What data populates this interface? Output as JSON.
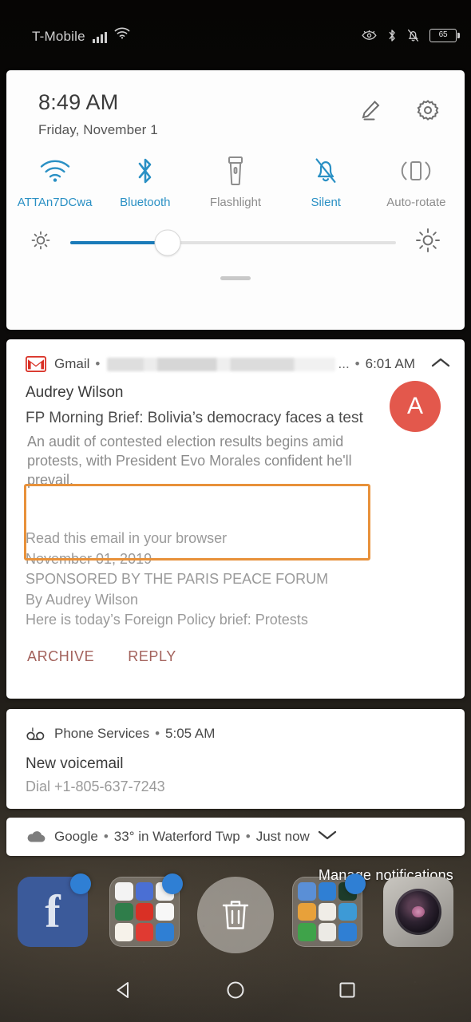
{
  "status_bar": {
    "carrier": "T-Mobile",
    "signal_icon": "signal-bars-icon",
    "wifi_icon": "wifi-icon",
    "eye_comfort_icon": "eye-comfort-icon",
    "bluetooth_icon": "bluetooth-icon",
    "silent_icon": "bell-slash-icon",
    "battery_level": "65"
  },
  "quick_settings": {
    "time": "8:49 AM",
    "date": "Friday, November 1",
    "edit_icon": "pencil-edit-icon",
    "settings_icon": "gear-icon",
    "active_color": "#2a90c4",
    "inactive_color": "#8d8d8d",
    "tiles": [
      {
        "label": "ATTAn7DCwa",
        "icon": "wifi-icon",
        "state": "on"
      },
      {
        "label": "Bluetooth",
        "icon": "bluetooth-icon",
        "state": "on"
      },
      {
        "label": "Flashlight",
        "icon": "flashlight-icon",
        "state": "off"
      },
      {
        "label": "Silent",
        "icon": "bell-slash-icon",
        "state": "on"
      },
      {
        "label": "Auto-rotate",
        "icon": "auto-rotate-icon",
        "state": "off"
      }
    ],
    "brightness": {
      "low_icon": "brightness-low-icon",
      "high_icon": "brightness-high-icon",
      "value_percent": "30"
    },
    "drag_handle": "panel-drag-handle"
  },
  "notifications": {
    "gmail": {
      "app_icon": "gmail-icon",
      "app_name": "Gmail",
      "account": "",
      "account_truncation": "...",
      "time": "6:01 AM",
      "collapse_icon": "chevron-up-icon",
      "sender": "Audrey Wilson",
      "subject": "FP Morning Brief: Bolivia’s democracy faces a test",
      "avatar_letter": "A",
      "avatar_color": "#e3584c",
      "preview": "An audit of contested election results begins amid protests, with President Evo Morales confident he'll prevail.",
      "body_lines": [
        "Read this email in your browser",
        "November 01, 2019",
        "SPONSORED BY THE PARIS PEACE FORUM",
        "By Audrey Wilson",
        "Here is today’s Foreign Policy brief: Protests"
      ],
      "actions": [
        {
          "label": "ARCHIVE"
        },
        {
          "label": "REPLY"
        }
      ],
      "annotation": {
        "shape": "rectangle",
        "color": "#e8913a",
        "target": "preview"
      }
    },
    "voicemail": {
      "app_icon": "voicemail-icon",
      "app_name": "Phone Services",
      "time": "5:05 AM",
      "title": "New voicemail",
      "subtitle": "Dial +1-805-637-7243"
    },
    "weather": {
      "app_icon": "cloud-icon",
      "app_name": "Google",
      "summary": "33° in Waterford Twp",
      "time": "Just now",
      "expand_icon": "chevron-down-icon"
    },
    "manage_label": "Manage notifications"
  },
  "dock": {
    "items": [
      {
        "name": "facebook",
        "glyph": "f",
        "badge": true
      },
      {
        "name": "google-folder",
        "badge": true
      },
      {
        "name": "delete-target",
        "icon": "trash-icon",
        "badge": false
      },
      {
        "name": "social-folder",
        "badge": true
      },
      {
        "name": "camera",
        "icon": "camera-icon",
        "badge": false
      }
    ]
  },
  "nav_bar": {
    "back_icon": "back-triangle-icon",
    "home_icon": "home-circle-icon",
    "recents_icon": "recents-square-icon"
  }
}
